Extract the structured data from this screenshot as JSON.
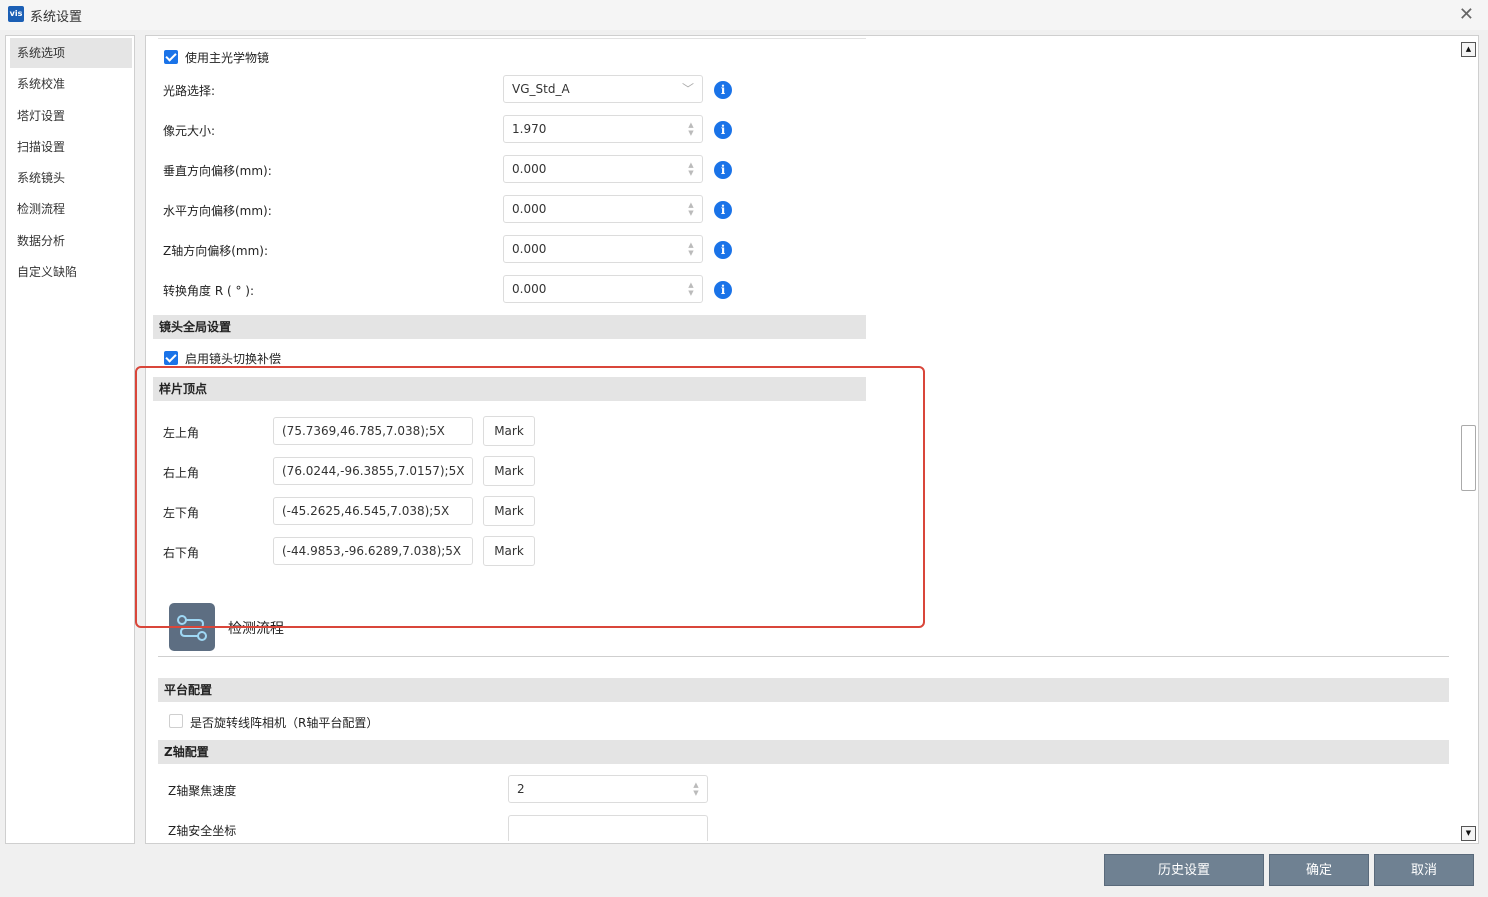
{
  "window": {
    "title": "系统设置",
    "app_icon_text": "vis"
  },
  "sidebar": {
    "items": [
      {
        "label": "系统选项",
        "active": true
      },
      {
        "label": "系统校准"
      },
      {
        "label": "塔灯设置"
      },
      {
        "label": "扫描设置"
      },
      {
        "label": "系统镜头"
      },
      {
        "label": "检测流程"
      },
      {
        "label": "数据分析"
      },
      {
        "label": "自定义缺陷"
      }
    ]
  },
  "main": {
    "use_main_objective": {
      "label": "使用主光学物镜",
      "checked": true
    },
    "fields": [
      {
        "label": "光路选择:",
        "value": "VG_Std_A",
        "kind": "dropdown"
      },
      {
        "label": "像元大小:",
        "value": "1.970",
        "kind": "spin"
      },
      {
        "label": "垂直方向偏移(mm):",
        "value": "0.000",
        "kind": "spin"
      },
      {
        "label": "水平方向偏移(mm):",
        "value": "0.000",
        "kind": "spin"
      },
      {
        "label": "Z轴方向偏移(mm):",
        "value": "0.000",
        "kind": "spin"
      },
      {
        "label": "转换角度 R ( ° ):",
        "value": "0.000",
        "kind": "spin"
      }
    ],
    "lens_global": {
      "title": "镜头全局设置",
      "switch_comp": {
        "label": "启用镜头切换补偿",
        "checked": true
      }
    },
    "sample_vertices": {
      "title": "样片顶点",
      "mark_label": "Mark",
      "rows": [
        {
          "label": "左上角",
          "value": "(75.7369,46.785,7.038);5X"
        },
        {
          "label": "右上角",
          "value": "(76.0244,-96.3855,7.0157);5X"
        },
        {
          "label": "左下角",
          "value": "(-45.2625,46.545,7.038);5X"
        },
        {
          "label": "右下角",
          "value": "(-44.9853,-96.6289,7.038);5X"
        }
      ]
    },
    "detection_flow": {
      "label": "检测流程"
    },
    "platform": {
      "title": "平台配置",
      "rotate_camera": {
        "label": "是否旋转线阵相机（R轴平台配置）",
        "checked": false
      }
    },
    "z_axis": {
      "title": "Z轴配置",
      "focus_speed": {
        "label": "Z轴聚焦速度",
        "value": "2"
      },
      "safe_coord": {
        "label": "Z轴安全坐标",
        "value": ""
      }
    }
  },
  "footer": {
    "history_label": "历史设置",
    "ok_label": "确定",
    "cancel_label": "取消"
  },
  "colors": {
    "accent": "#1a73e8",
    "highlight_box": "#d9463a",
    "footer_button": "#6f8192"
  }
}
